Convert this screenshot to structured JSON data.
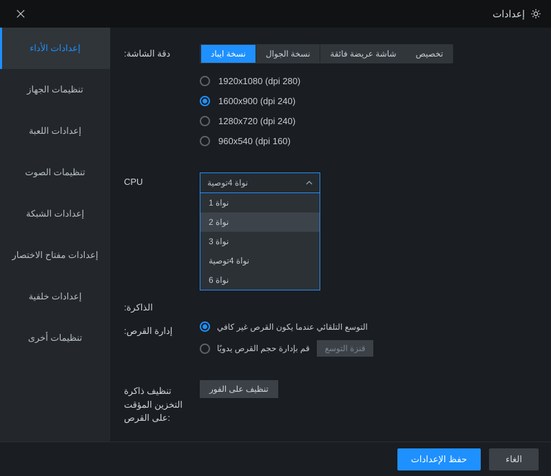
{
  "titlebar": {
    "title": "إعدادات"
  },
  "sidebar": {
    "items": [
      {
        "label": "إعدادات الأداء",
        "active": true
      },
      {
        "label": "تنظيمات الجهاز"
      },
      {
        "label": "إعدادات اللعبة"
      },
      {
        "label": "تنظيمات الصوت"
      },
      {
        "label": "إعدادات الشبكة"
      },
      {
        "label": "إعدادات مفتاح الاختصار"
      },
      {
        "label": "إعدادات خلفية"
      },
      {
        "label": "تنظيمات أخرى"
      }
    ]
  },
  "resolution": {
    "label": ":دقة الشاشة",
    "tabs": [
      {
        "label": "نسخة ايباد",
        "active": true
      },
      {
        "label": "نسخة الجوال"
      },
      {
        "label": "شاشة عريضة فائقة"
      },
      {
        "label": "تخصيص"
      }
    ],
    "options": [
      {
        "label": "1920x1080  (dpi 280)",
        "selected": false
      },
      {
        "label": "1600x900  (dpi 240)",
        "selected": true
      },
      {
        "label": "1280x720  (dpi 240)",
        "selected": false
      },
      {
        "label": "960x540  (dpi 160)",
        "selected": false
      }
    ]
  },
  "cpu": {
    "label": "CPU",
    "selected": "نواة 4توصية",
    "options": [
      {
        "label": "نواة 1"
      },
      {
        "label": "نواة 2",
        "hover": true
      },
      {
        "label": "نواة 3"
      },
      {
        "label": "نواة 4توصية"
      },
      {
        "label": "نواة 6"
      }
    ]
  },
  "memory": {
    "label": ":الذاكرة"
  },
  "disk": {
    "label": ":إدارة القرص",
    "auto": "التوسع التلقائي عندما يكون القرص غير كافي",
    "manual": "قم بإدارة حجم القرص يدويًا",
    "expand_btn": "قنزة التوسع"
  },
  "cache": {
    "label": "تنظيف ذاكرة التخزين المؤقت على القرص:",
    "button": "تنظيف على الفور"
  },
  "footer": {
    "save": "حفظ الإعدادات",
    "cancel": "الغاء"
  }
}
